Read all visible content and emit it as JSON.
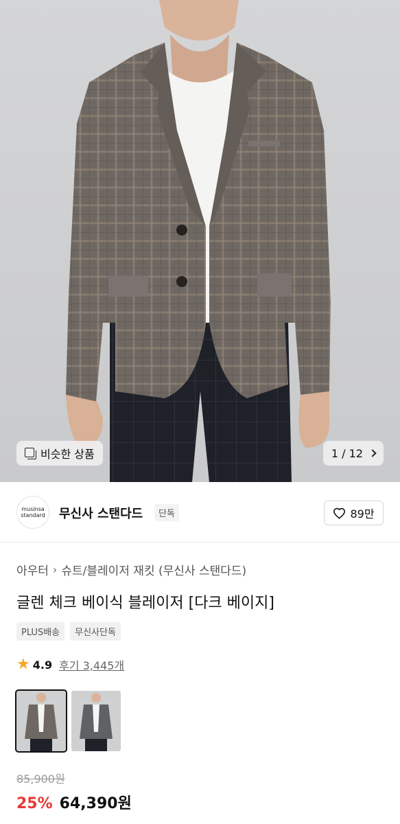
{
  "hero": {
    "similar_label": "비슷한 상품",
    "counter": "1 / 12",
    "colors": {
      "background": "#cfd0d2",
      "jacket": "#6e6660",
      "shirt": "#f4f4f2",
      "pants": "#1d1f26"
    }
  },
  "brand": {
    "logo_line1": "musinsa",
    "logo_line2": "standard",
    "name": "무신사 스탠다드",
    "badge": "단독",
    "likes": "89만"
  },
  "breadcrumb": [
    "아우터",
    "슈트/블레이저 재킷 (무신사 스탠다드)"
  ],
  "title": "글렌 체크 베이식 블레이저 [다크 베이지]",
  "tags": [
    "PLUS배송",
    "무신사단독"
  ],
  "rating": {
    "value": "4.9",
    "reviews": "후기 3,445개"
  },
  "thumbnails": [
    {
      "name": "dark-beige",
      "selected": true
    },
    {
      "name": "gray",
      "selected": false
    }
  ],
  "price": {
    "original": "85,900원",
    "discount": "25%",
    "sale": "64,390원",
    "discount_color": "#e53935"
  }
}
